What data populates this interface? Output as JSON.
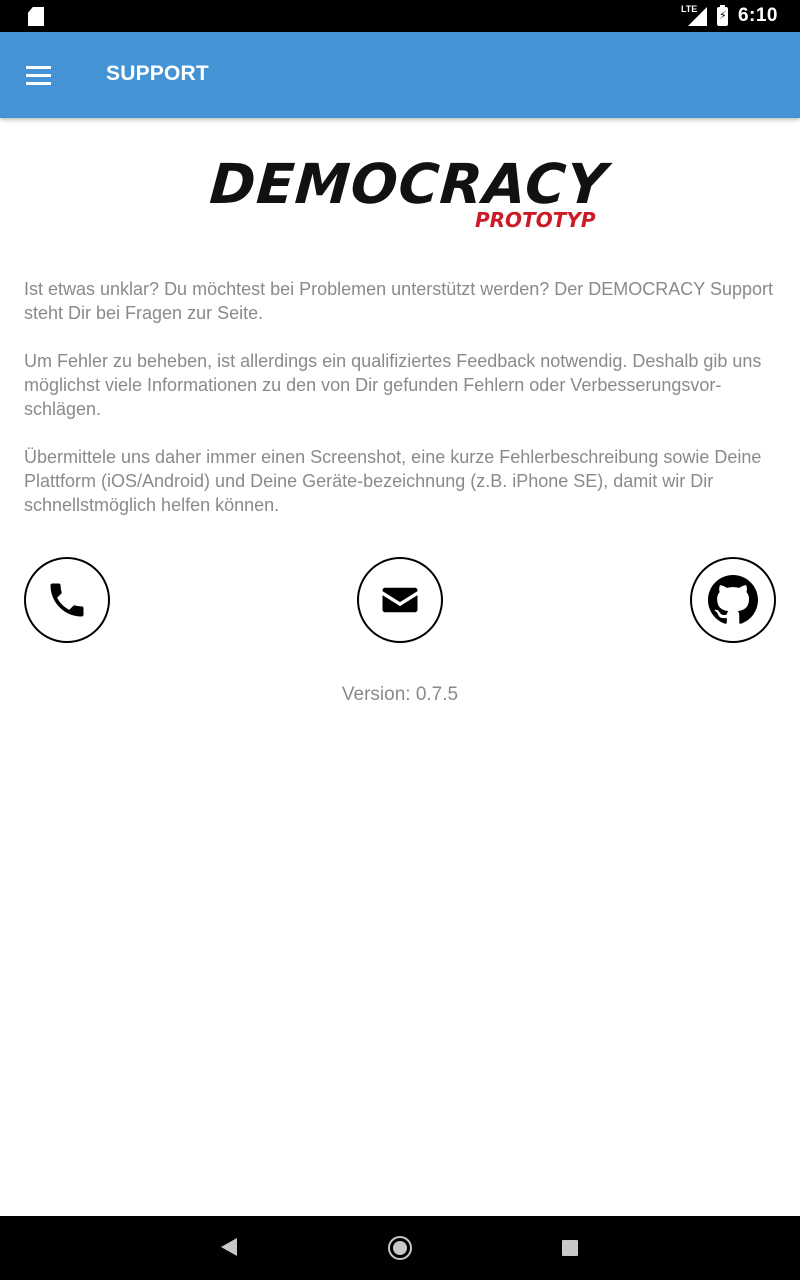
{
  "status_bar": {
    "time": "6:10",
    "network": "LTE",
    "icons": [
      "sd-card-icon",
      "signal-icon",
      "battery-charging-icon"
    ]
  },
  "app_bar": {
    "title": "SUPPORT",
    "menu_icon": "hamburger-menu-icon",
    "background_color": "#4494d5"
  },
  "logo": {
    "text": "DEMOCRACY",
    "subtext": "PROTOTYP",
    "subtext_color": "#cc1a26"
  },
  "content": {
    "paragraphs": [
      "Ist etwas unklar? Du möchtest bei Problemen unterstützt werden? Der DEMOCRACY Support steht Dir bei Fragen zur Seite.",
      "Um Fehler zu beheben, ist allerdings ein qualifiziertes Feedback notwendig. Deshalb gib uns möglichst viele Informationen zu den von Dir gefunden Fehlern oder Verbesserungsvor-schlägen.",
      "Übermittele uns daher immer einen Screenshot, eine kurze Fehlerbeschreibung sowie Deine Plattform (iOS/Android) und Deine Geräte-bezeichnung (z.B. iPhone SE), damit wir Dir schnellstmöglich helfen können."
    ]
  },
  "contact_buttons": [
    {
      "name": "phone",
      "icon": "phone-icon"
    },
    {
      "name": "mail",
      "icon": "envelope-icon"
    },
    {
      "name": "github",
      "icon": "github-icon"
    }
  ],
  "version": "Version: 0.7.5",
  "nav_bar": {
    "icons": [
      "back-icon",
      "home-icon",
      "recents-icon"
    ]
  }
}
